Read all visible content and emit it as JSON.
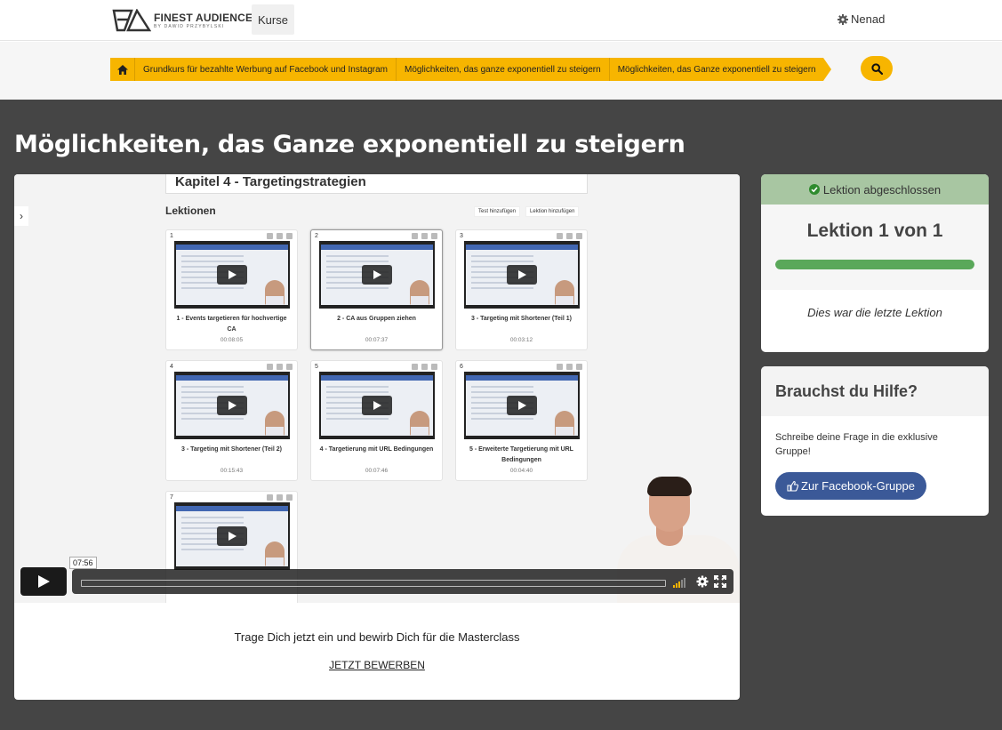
{
  "header": {
    "logo_title": "FINEST AUDIENCE",
    "logo_sub": "BY DAWID PRZYBYLSKI",
    "nav_kurse": "Kurse",
    "user_name": "Nenad"
  },
  "breadcrumb": {
    "items": [
      "Grundkurs für bezahlte Werbung auf Facebook und Instagram",
      "Möglichkeiten, das ganze exponentiell zu steigern",
      "Möglichkeiten, das Ganze exponentiell zu steigern"
    ],
    "accent_color": "#f7b500"
  },
  "page_title": "Möglichkeiten, das Ganze exponentiell zu steigern",
  "video": {
    "chapter_title": "Kapitel 4 - Targetingstrategien",
    "lessons_heading": "Lektionen",
    "btn_test": "Test hinzufügen",
    "btn_lektion": "Lektion hinzufügen",
    "tiles": [
      {
        "num": "1",
        "title": "1 - Events targetieren für hochvertige CA",
        "duration": "00:08:05"
      },
      {
        "num": "2",
        "title": "2 - CA aus Gruppen ziehen",
        "duration": "00:07:37"
      },
      {
        "num": "3",
        "title": "3 - Targeting mit Shortener (Teil 1)",
        "duration": "00:03:12"
      },
      {
        "num": "4",
        "title": "3 - Targeting mit Shortener (Teil 2)",
        "duration": "00:15:43"
      },
      {
        "num": "5",
        "title": "4 - Targetierung mit URL Bedingungen",
        "duration": "00:07:46"
      },
      {
        "num": "6",
        "title": "5 - Erweiterte Targetierung mit URL Bedingungen",
        "duration": "00:04:40"
      },
      {
        "num": "7",
        "title": "",
        "duration": ""
      }
    ],
    "current_time": "07:56"
  },
  "cta": {
    "text": "Trage Dich jetzt ein und bewirb Dich für die Masterclass",
    "link": "JETZT BEWERBEN"
  },
  "progress_card": {
    "status": "Lektion abgeschlossen",
    "lesson_counter": "Lektion 1 von 1",
    "progress_fraction": 1.0,
    "footer": "Dies war die letzte Lektion",
    "status_color": "#a8c6a2",
    "bar_color": "#5aa85a"
  },
  "help_card": {
    "title": "Brauchst du Hilfe?",
    "text": "Schreibe deine Frage in die exklusive Gruppe!",
    "button": "Zur Facebook-Gruppe",
    "button_color": "#3b5998"
  }
}
